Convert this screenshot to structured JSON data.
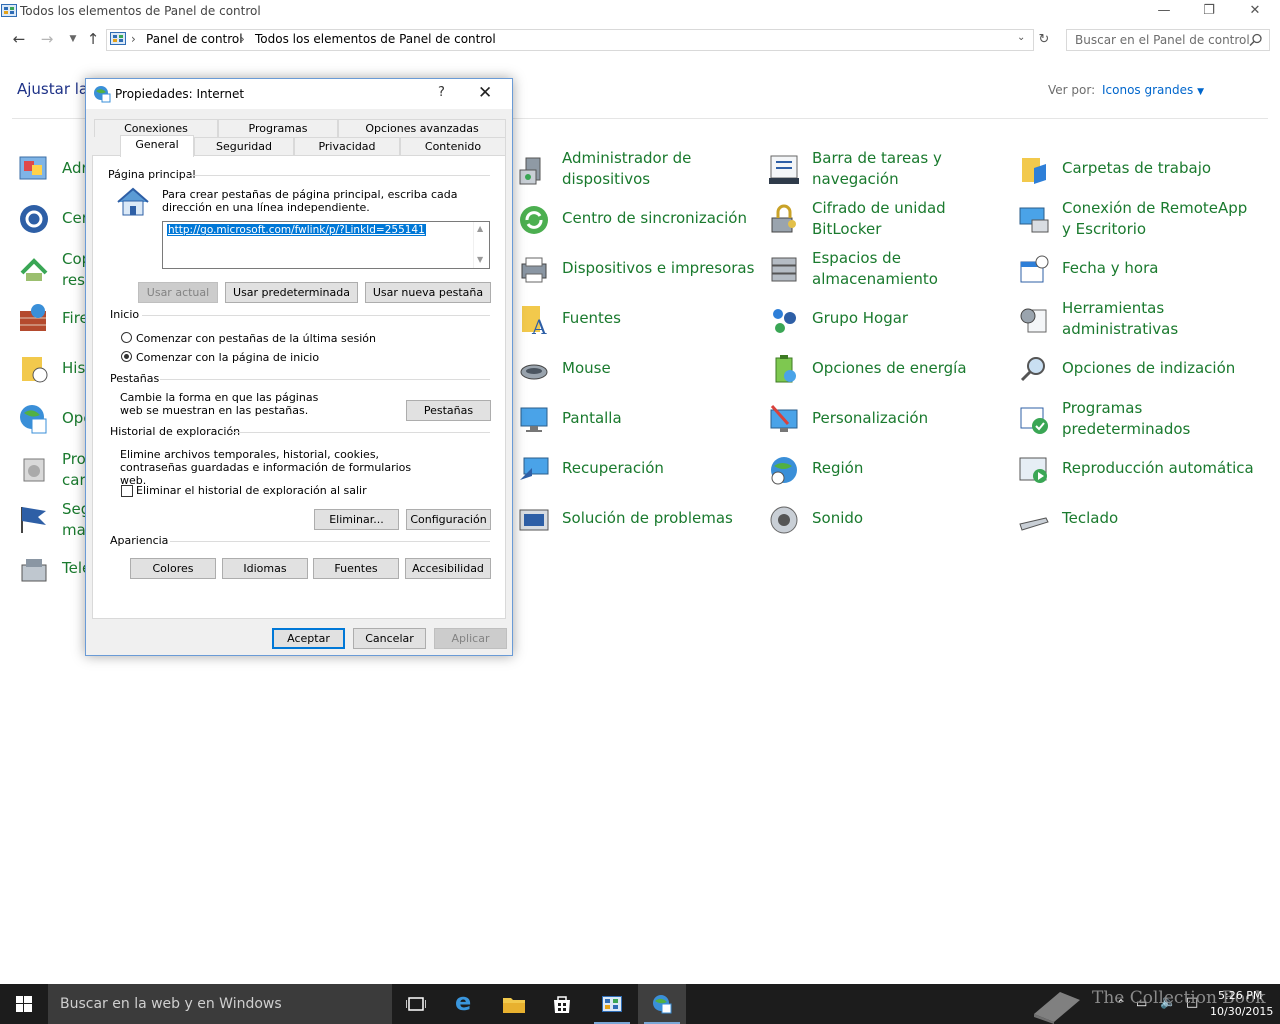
{
  "window": {
    "title": "Todos los elementos de Panel de control",
    "breadcrumb": [
      "Panel de control",
      "Todos los elementos de Panel de control"
    ],
    "search_placeholder": "Buscar en el Panel de control"
  },
  "page": {
    "heading": "Ajustar la",
    "view_by_label": "Ver por:",
    "view_by_value": "Iconos grandes"
  },
  "left_partial_items": [
    "Adr",
    "Cer",
    "Cop",
    "rest",
    "Fire",
    "Hist",
    "Opc",
    "Pro",
    "cara",
    "Seg",
    "ma",
    "Telé"
  ],
  "control_panel_items": [
    {
      "label": "Administrador de dispositivos",
      "icon": "device-manager-icon"
    },
    {
      "label": "Barra de tareas y navegación",
      "icon": "taskbar-icon"
    },
    {
      "label": "Carpetas de trabajo",
      "icon": "work-folders-icon"
    },
    {
      "label": "Centro de sincronización",
      "icon": "sync-center-icon"
    },
    {
      "label": "Cifrado de unidad BitLocker",
      "icon": "bitlocker-icon"
    },
    {
      "label": "Conexión de RemoteApp y Escritorio",
      "icon": "remoteapp-icon"
    },
    {
      "label": "Dispositivos e impresoras",
      "icon": "printer-icon"
    },
    {
      "label": "Espacios de almacenamiento",
      "icon": "storage-spaces-icon"
    },
    {
      "label": "Fecha y hora",
      "icon": "calendar-clock-icon"
    },
    {
      "label": "Fuentes",
      "icon": "fonts-icon"
    },
    {
      "label": "Grupo Hogar",
      "icon": "homegroup-icon"
    },
    {
      "label": "Herramientas administrativas",
      "icon": "admin-tools-icon"
    },
    {
      "label": "Mouse",
      "icon": "mouse-icon"
    },
    {
      "label": "Opciones de energía",
      "icon": "power-icon"
    },
    {
      "label": "Opciones de indización",
      "icon": "indexing-icon"
    },
    {
      "label": "Pantalla",
      "icon": "display-icon"
    },
    {
      "label": "Personalización",
      "icon": "personalization-icon"
    },
    {
      "label": "Programas predeterminados",
      "icon": "default-programs-icon"
    },
    {
      "label": "Recuperación",
      "icon": "recovery-icon"
    },
    {
      "label": "Región",
      "icon": "region-icon"
    },
    {
      "label": "Reproducción automática",
      "icon": "autoplay-icon"
    },
    {
      "label": "Solución de problemas",
      "icon": "troubleshooting-icon"
    },
    {
      "label": "Sonido",
      "icon": "sound-icon"
    },
    {
      "label": "Teclado",
      "icon": "keyboard-icon"
    }
  ],
  "dialog": {
    "title": "Propiedades: Internet",
    "help": "?",
    "tabs_row1": [
      "Conexiones",
      "Programas",
      "Opciones avanzadas"
    ],
    "tabs_row2": [
      "General",
      "Seguridad",
      "Privacidad",
      "Contenido"
    ],
    "active_tab": "General",
    "home_page": {
      "group": "Página principal",
      "description": "Para crear pestañas de página principal, escriba cada dirección en una línea independiente.",
      "url": "http://go.microsoft.com/fwlink/p/?LinkId=255141",
      "btn_current": "Usar actual",
      "btn_default": "Usar predeterminada",
      "btn_new_tab": "Usar nueva pestaña"
    },
    "startup": {
      "group": "Inicio",
      "option_last_session": "Comenzar con pestañas de la última sesión",
      "option_home_page": "Comenzar con la página de inicio",
      "selected": "home_page"
    },
    "tabs_section": {
      "group": "Pestañas",
      "description": "Cambie la forma en que las páginas web se muestran en las pestañas.",
      "button": "Pestañas"
    },
    "history": {
      "group": "Historial de exploración",
      "description": "Elimine archivos temporales, historial, cookies, contraseñas guardadas e información de formularios web.",
      "checkbox": "Eliminar el historial de exploración al salir",
      "checked": false,
      "btn_delete": "Eliminar...",
      "btn_settings": "Configuración"
    },
    "appearance": {
      "group": "Apariencia",
      "btn_colors": "Colores",
      "btn_languages": "Idiomas",
      "btn_fonts": "Fuentes",
      "btn_accessibility": "Accesibilidad"
    },
    "footer": {
      "ok": "Aceptar",
      "cancel": "Cancelar",
      "apply": "Aplicar"
    }
  },
  "taskbar": {
    "search_placeholder": "Buscar en la web y en Windows",
    "clock_time": "5:26 PM",
    "clock_date": "10/30/2015",
    "watermark": "The Collection Book"
  },
  "colors": {
    "item_green": "#1a7a2e",
    "link_blue": "#0066cc",
    "accent": "#0078d7",
    "taskbar": "#1c1c1c"
  }
}
